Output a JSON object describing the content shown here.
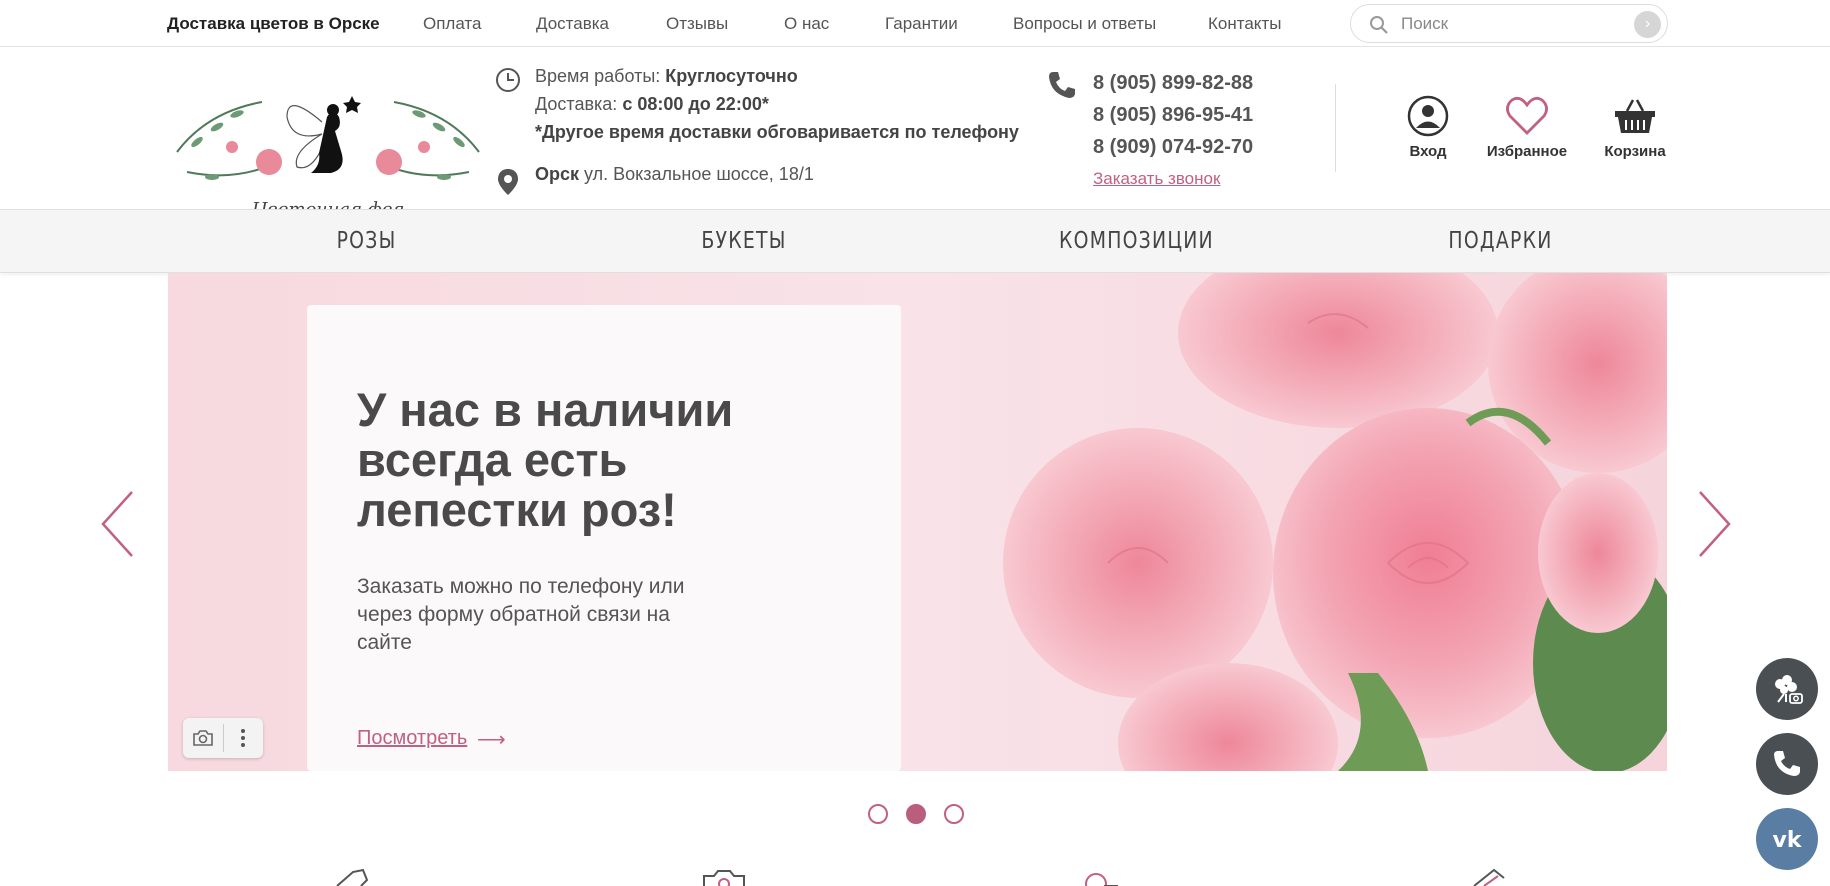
{
  "topbar": {
    "brand": "Доставка цветов в Орске",
    "nav": [
      "Оплата",
      "Доставка",
      "Отзывы",
      "О нас",
      "Гарантии",
      "Вопросы и ответы",
      "Контакты"
    ],
    "search_placeholder": "Поиск"
  },
  "logo": {
    "text": "Цветочная фея"
  },
  "info": {
    "hours_label": "Время работы:",
    "hours_value": "Круглосуточно",
    "delivery_label": "Доставка:",
    "delivery_value": "с 08:00 до 22:00*",
    "note": "*Другое время доставки обговаривается по телефону",
    "city": "Орск",
    "address": "ул. Вокзальное шоссе, 18/1"
  },
  "phones": {
    "numbers": [
      "8 (905) 899-82-88",
      "8 (905) 896-95-41",
      "8 (909) 074-92-70"
    ],
    "callback": "Заказать звонок"
  },
  "user": {
    "login": "Вход",
    "favorites": "Избранное",
    "cart": "Корзина"
  },
  "categories": [
    "РОЗЫ",
    "БУКЕТЫ",
    "КОМПОЗИЦИИ",
    "ПОДАРКИ"
  ],
  "slide": {
    "title": "У нас в наличии всегда есть лепестки роз!",
    "text": "Заказать можно по телефону или через форму обратной связи на сайте",
    "link": "Посмотреть",
    "link_arrow": "⟶"
  },
  "slider": {
    "count": 3,
    "active_index": 1
  },
  "colors": {
    "accent": "#c2617f",
    "fab_dark": "#4a4f54",
    "fab_vk": "#5a7ea3"
  },
  "icons": [
    "search-icon",
    "clock-icon",
    "location-pin-icon",
    "phone-icon",
    "user-icon",
    "heart-icon",
    "basket-icon",
    "camera-icon",
    "more-vertical-icon",
    "chevron-left-icon",
    "chevron-right-icon",
    "flower-icon",
    "vk-icon"
  ]
}
